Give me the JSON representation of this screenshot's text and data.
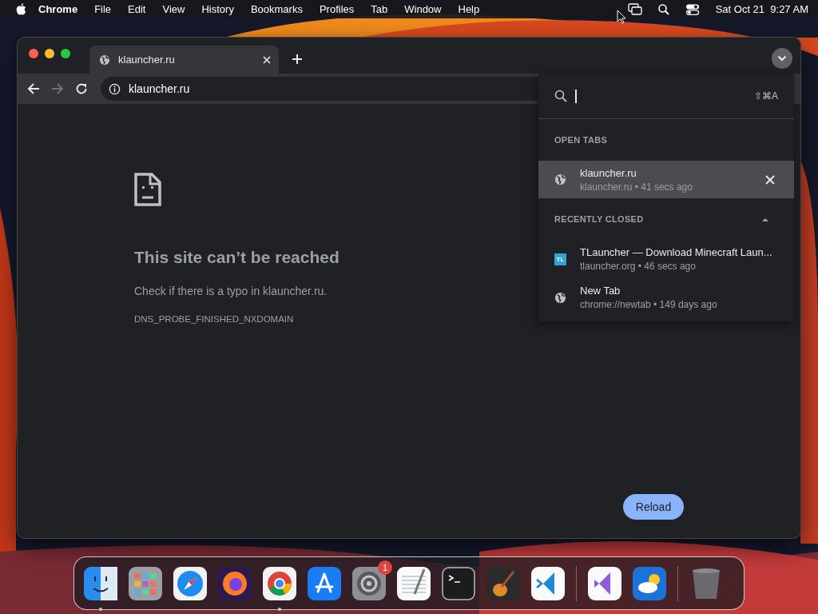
{
  "menu_bar": {
    "app": "Chrome",
    "menus": [
      "File",
      "Edit",
      "View",
      "History",
      "Bookmarks",
      "Profiles",
      "Tab",
      "Window",
      "Help"
    ],
    "clock": "Sat Oct 21  9:27 AM"
  },
  "browser": {
    "tabs": [
      {
        "title": "klauncher.ru",
        "selected": true
      }
    ],
    "toolbar": {
      "back_disabled": false,
      "forward_disabled": true,
      "url": "klauncher.ru"
    },
    "error_page": {
      "title": "This site can’t be reached",
      "message": "Check if there is a typo in klauncher.ru.",
      "code": "DNS_PROBE_FINISHED_NXDOMAIN",
      "reload": "Reload"
    },
    "tab_search": {
      "shortcut": "⇧⌘A",
      "open_tabs": {
        "heading": "OPEN TABS",
        "items": [
          {
            "title": "klauncher.ru",
            "subtitle": "klauncher.ru • 41 secs ago",
            "kind": "globe",
            "selected": true
          }
        ]
      },
      "recently_closed": {
        "heading": "RECENTLY CLOSED",
        "expanded": true,
        "items": [
          {
            "title": "TLauncher — Download Minecraft Laun...",
            "subtitle": "tlauncher.org • 46 secs ago",
            "kind": "letters",
            "favicon_text": "TL",
            "selected": false
          },
          {
            "title": "New Tab",
            "subtitle": "chrome://newtab • 149 days ago",
            "kind": "globe",
            "selected": false
          }
        ]
      }
    }
  },
  "dock": {
    "items": [
      {
        "kind": "finder",
        "running": true
      },
      {
        "kind": "launchpad",
        "running": false
      },
      {
        "kind": "safari",
        "running": false
      },
      {
        "kind": "firefox",
        "running": false
      },
      {
        "kind": "chrome",
        "running": true
      },
      {
        "kind": "appstore",
        "running": false
      },
      {
        "kind": "settings",
        "running": false,
        "badge": "1"
      },
      {
        "kind": "textedit",
        "running": false
      },
      {
        "kind": "terminal",
        "running": false
      },
      {
        "kind": "garageband",
        "running": false
      },
      {
        "kind": "vscode",
        "running": false
      },
      {
        "kind": "divider"
      },
      {
        "kind": "visualstudio",
        "running": false
      },
      {
        "kind": "weather",
        "running": false
      },
      {
        "kind": "divider"
      },
      {
        "kind": "trash",
        "running": false
      }
    ]
  }
}
